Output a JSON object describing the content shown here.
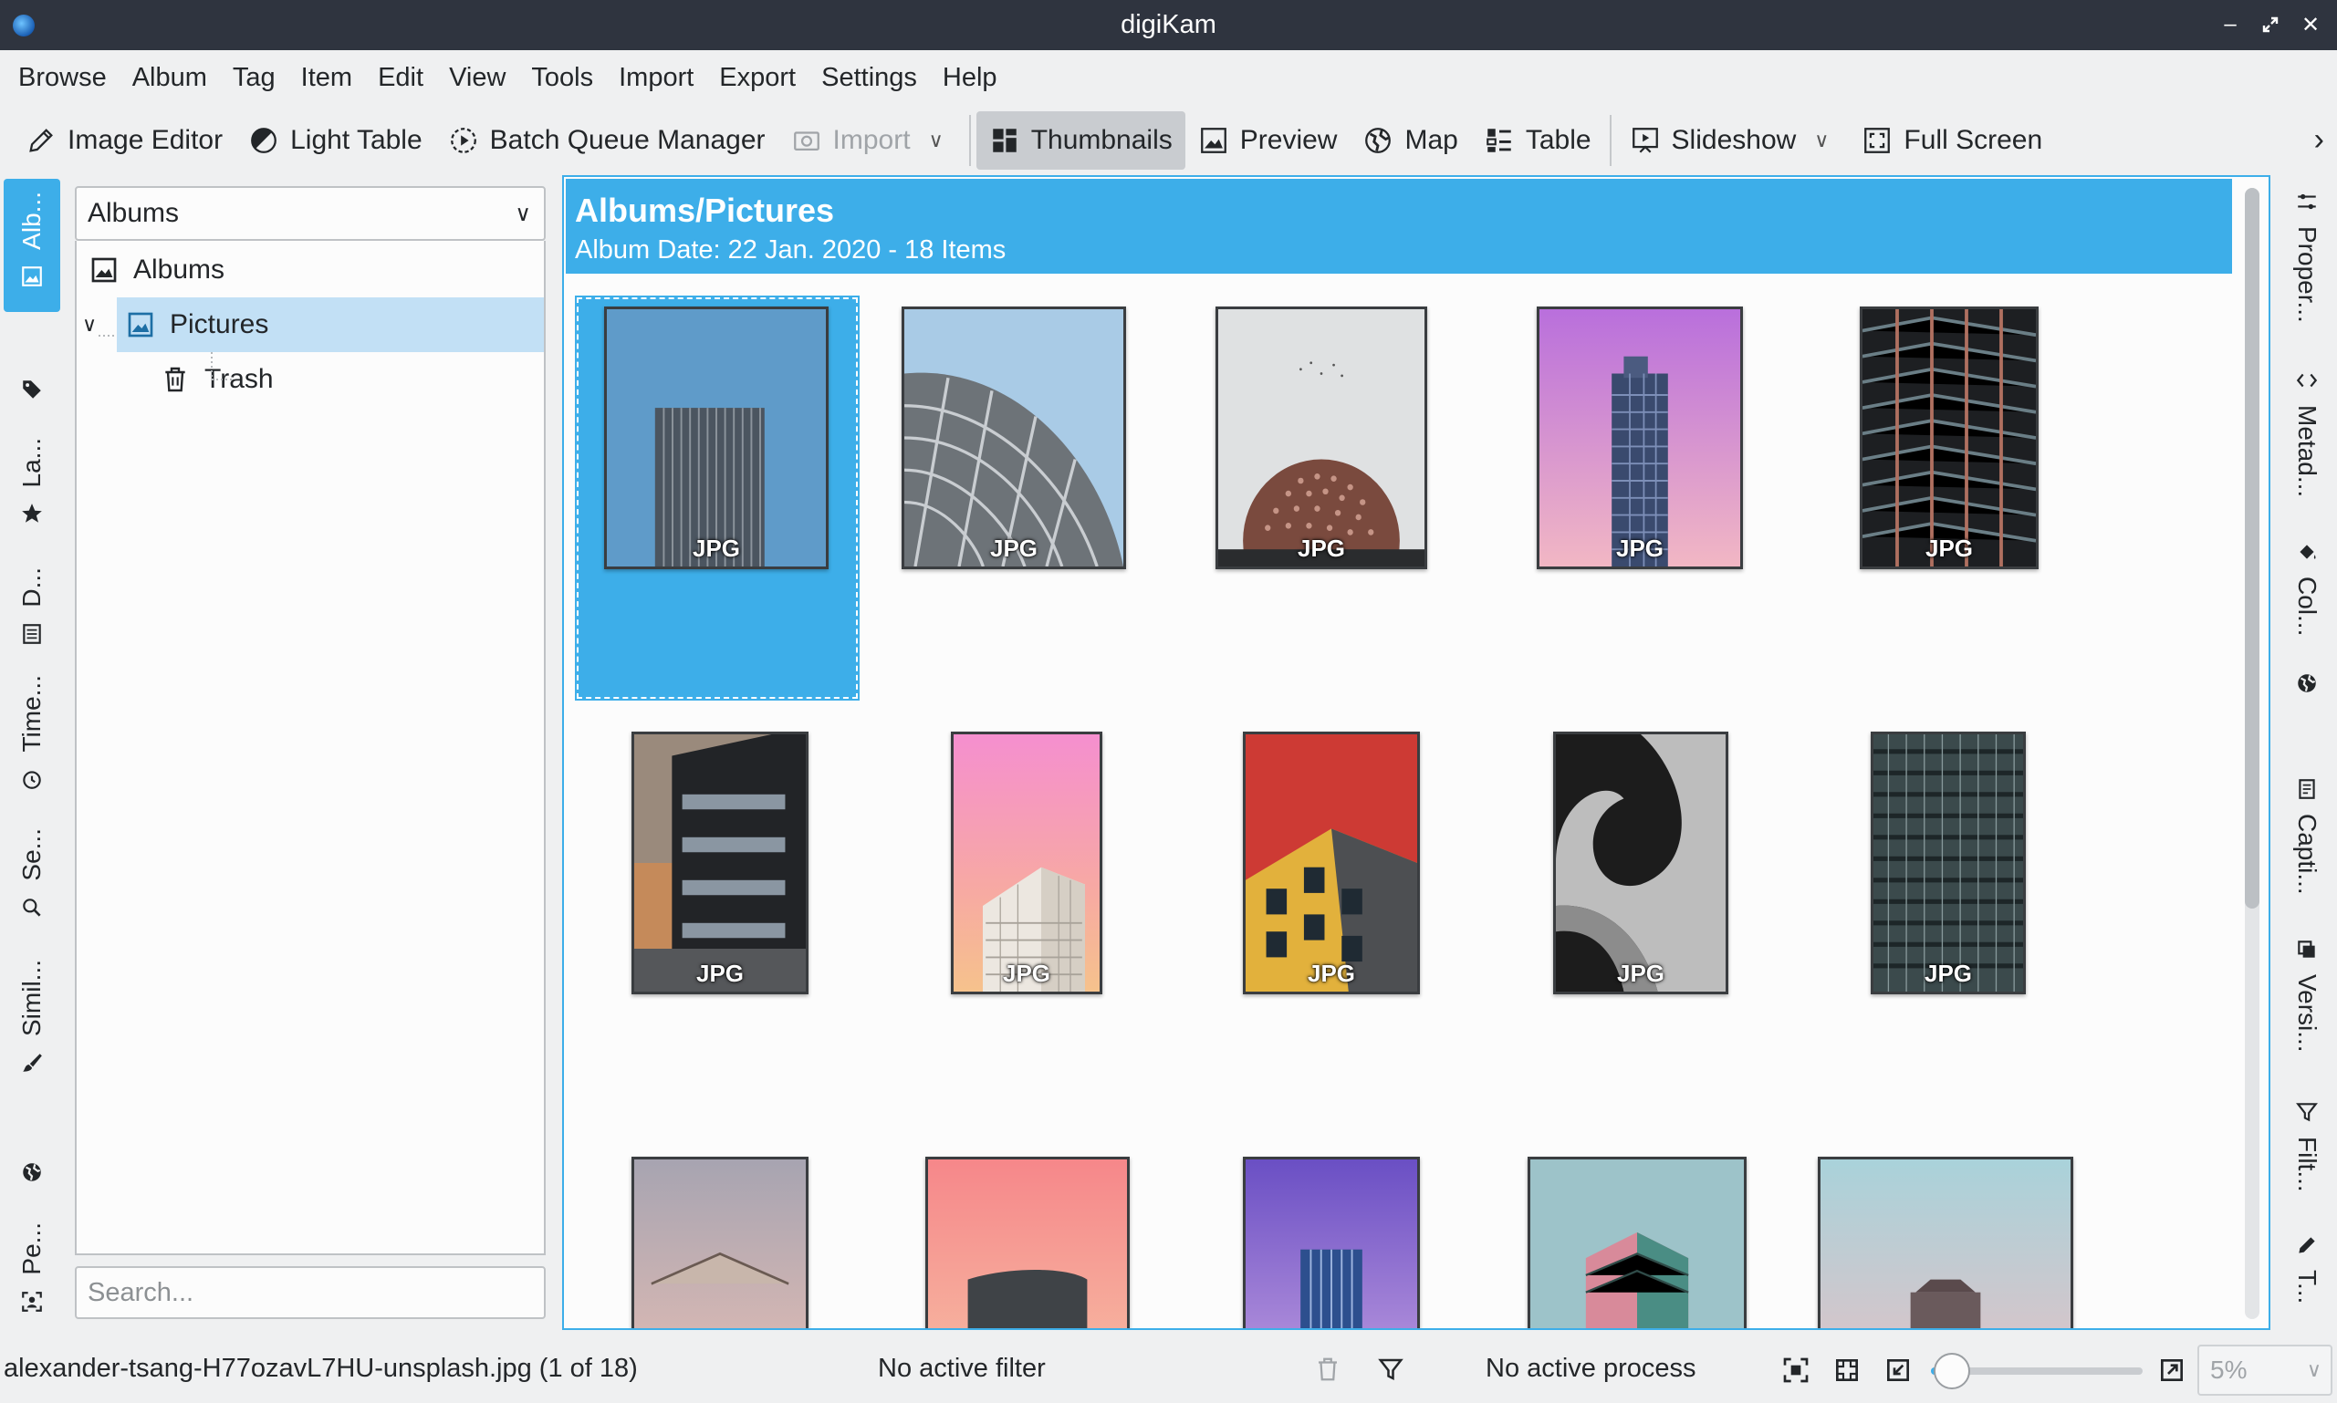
{
  "window": {
    "title": "digiKam",
    "buttons": [
      "minimize",
      "maximize",
      "close"
    ]
  },
  "menubar": {
    "items": [
      "Browse",
      "Album",
      "Tag",
      "Item",
      "Edit",
      "View",
      "Tools",
      "Import",
      "Export",
      "Settings",
      "Help"
    ]
  },
  "toolbar": {
    "image_editor": "Image Editor",
    "light_table": "Light Table",
    "batch_queue": "Batch Queue Manager",
    "import": "Import",
    "thumbnails": "Thumbnails",
    "preview": "Preview",
    "map": "Map",
    "table": "Table",
    "slideshow": "Slideshow",
    "full_screen": "Full Screen"
  },
  "left_tabs": {
    "albums": "Alb...",
    "labels": "La...",
    "dates": "D...",
    "timeline": "Time...",
    "search": "Se...",
    "similarity": "Simil...",
    "people": "Pe..."
  },
  "album_panel": {
    "combo_value": "Albums",
    "tree": {
      "root": "Albums",
      "selected": "Pictures",
      "child": "Trash"
    },
    "search_placeholder": "Search..."
  },
  "main": {
    "header_title": "Albums/Pictures",
    "header_subtitle": "Album Date: 22 Jan. 2020 - 18 Items",
    "format_label": "JPG"
  },
  "right_tabs": {
    "properties": "Proper...",
    "metadata": "Metad...",
    "colors": "Col...",
    "captions": "Capti...",
    "versions": "Versi...",
    "filters": "Filt...",
    "tools": "T..."
  },
  "statusbar": {
    "file": "alexander-tsang-H77ozavL7HU-unsplash.jpg (1 of 18)",
    "filter": "No active filter",
    "process": "No active process",
    "zoom": "5%",
    "zoom_level": 0.1
  },
  "colors": {
    "accent": "#3daee9",
    "titlebar": "#2f343f",
    "selection": "#c2e0f5"
  }
}
